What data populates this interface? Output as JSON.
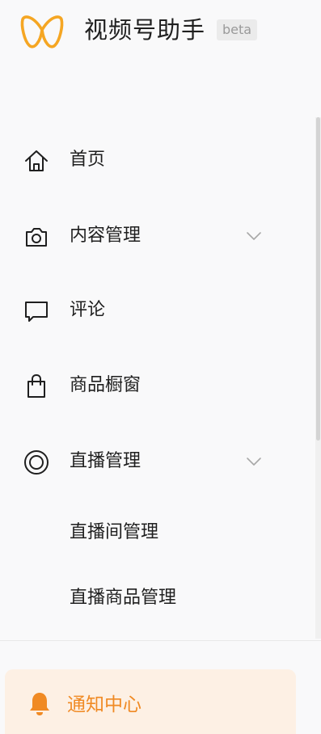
{
  "app": {
    "title": "视频号助手",
    "badge": "beta",
    "logo_icon": "butterfly-loop-logo",
    "accent_color": "#f5a623"
  },
  "nav": {
    "items": [
      {
        "label": "首页",
        "icon": "home-icon"
      },
      {
        "label": "内容管理",
        "icon": "camera-icon",
        "expandable": true,
        "expanded": false
      },
      {
        "label": "评论",
        "icon": "comment-icon"
      },
      {
        "label": "商品橱窗",
        "icon": "shopping-bag-icon"
      },
      {
        "label": "直播管理",
        "icon": "live-ring-icon",
        "expandable": true,
        "expanded": true,
        "children": [
          {
            "label": "直播间管理"
          },
          {
            "label": "直播商品管理"
          }
        ]
      }
    ]
  },
  "notification": {
    "label": "通知中心",
    "icon": "bell-icon",
    "color": "#f08a24",
    "background": "#fdf0e4"
  }
}
